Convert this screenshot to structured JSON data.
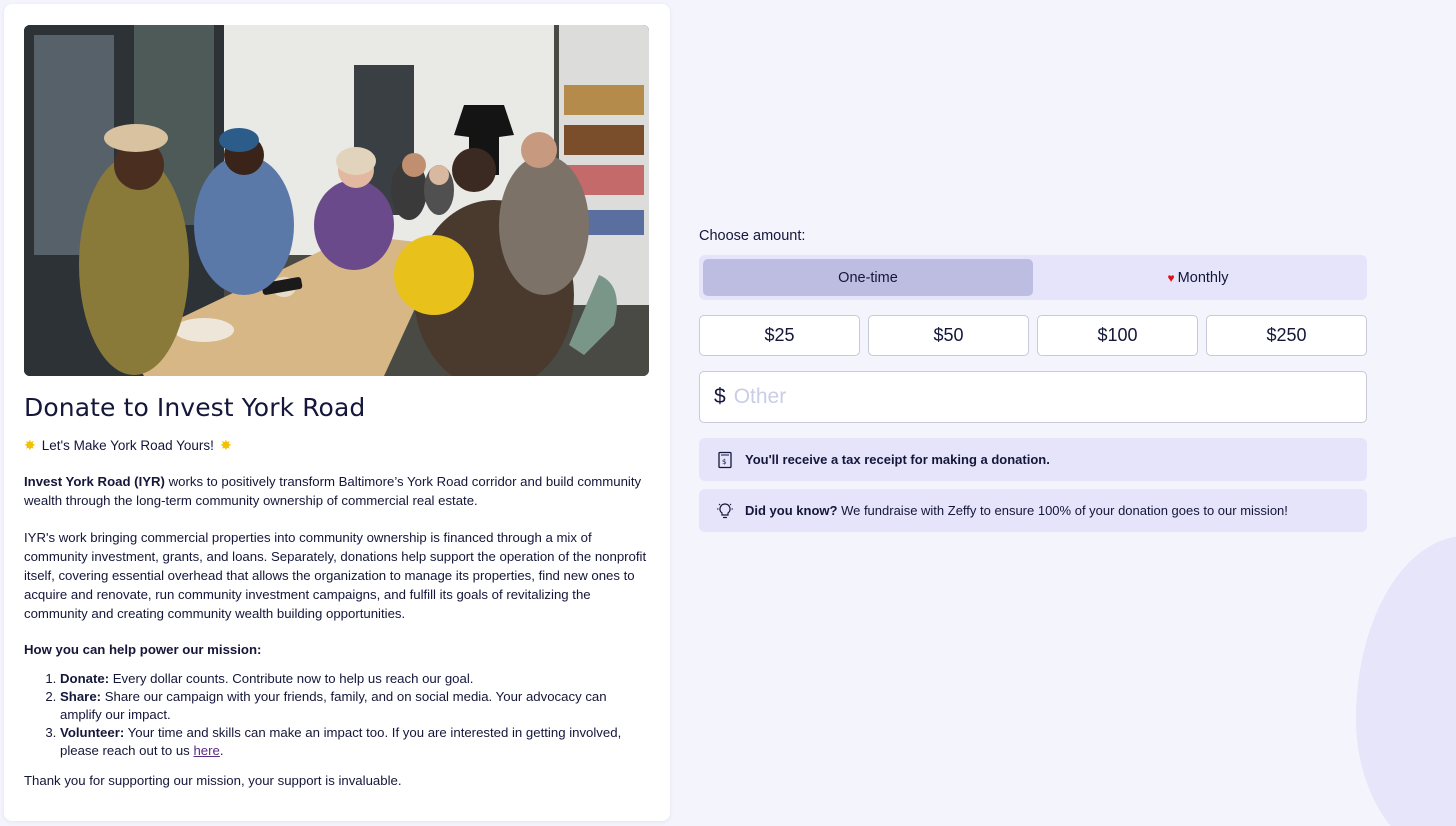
{
  "campaign": {
    "title": "Donate to Invest York Road",
    "tagline": "Let's Make York Road Yours!",
    "intro_bold": "Invest York Road (IYR)",
    "intro_rest": " works to positively transform Baltimore’s York Road corridor and build community wealth through the long-term community ownership of commercial real estate.",
    "paragraph2": "IYR's work bringing commercial properties into community ownership is financed through a mix of community investment, grants, and loans. Separately, donations help support the operation of the nonprofit itself, covering essential overhead that allows the organization to manage its properties, find new ones to acquire and renovate, run community investment campaigns, and fulfill its goals of revitalizing the community and creating community wealth building opportunities.",
    "help_title": "How you can help power our mission:",
    "help_items": [
      {
        "label": "Donate:",
        "text": " Every dollar counts. Contribute now to help us reach our goal."
      },
      {
        "label": "Share:",
        "text": " Share our campaign with your friends, family, and on social media. Your advocacy can amplify our impact."
      },
      {
        "label": "Volunteer:",
        "text": " Your time and skills can make an impact too. If you are interested in getting involved, please reach out to us ",
        "link": "here",
        "after": "."
      }
    ],
    "thanks": "Thank you for supporting our mission, your support is invaluable."
  },
  "donation": {
    "choose_label": "Choose amount:",
    "frequency": {
      "one_time": "One-time",
      "monthly": "Monthly",
      "selected": "One-time"
    },
    "amounts": [
      "$25",
      "$50",
      "$100",
      "$250"
    ],
    "currency_symbol": "$",
    "other_placeholder": "Other",
    "tax_notice": "You'll receive a tax receipt for making a donation.",
    "did_you_know_label": "Did you know?",
    "did_you_know_text": " We fundraise with Zeffy to ensure 100% of your donation goes to our mission!"
  },
  "colors": {
    "background": "#f4f4fd",
    "accent_light": "#e5e4fa",
    "selected_tab": "#bdbde2",
    "text": "#14163a",
    "heart": "#e01010",
    "link": "#5a2d82"
  },
  "icons": {
    "tagline_star": "sparkle-star-icon",
    "monthly": "heart-icon",
    "tax": "receipt-icon",
    "tip": "lightbulb-icon"
  }
}
